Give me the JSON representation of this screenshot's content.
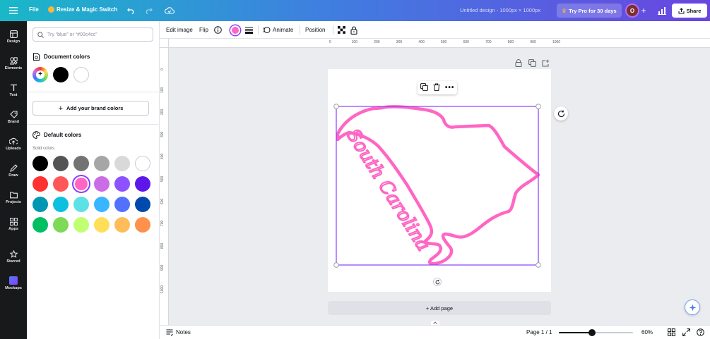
{
  "topbar": {
    "file_label": "File",
    "resize_label": "Resize & Magic Switch",
    "doc_title": "Untitled design - 1000px × 1000px",
    "try_pro_label": "Try Pro for 30 days",
    "avatar_letter": "O",
    "share_label": "Share"
  },
  "sidebar": {
    "items": [
      {
        "label": "Design",
        "icon": "design-icon"
      },
      {
        "label": "Elements",
        "icon": "elements-icon"
      },
      {
        "label": "Text",
        "icon": "text-icon"
      },
      {
        "label": "Brand",
        "icon": "brand-icon"
      },
      {
        "label": "Uploads",
        "icon": "uploads-icon"
      },
      {
        "label": "Draw",
        "icon": "draw-icon"
      },
      {
        "label": "Projects",
        "icon": "projects-icon"
      },
      {
        "label": "Apps",
        "icon": "apps-icon"
      },
      {
        "label": "Starred",
        "icon": "star-icon"
      },
      {
        "label": "Mockups",
        "icon": "mockups-icon"
      }
    ]
  },
  "panel": {
    "search_placeholder": "Try “blue” or “#00c4cc”",
    "document_colors_title": "Document colors",
    "document_colors": [
      "#000000",
      "#ffffff"
    ],
    "add_brand_label": "Add your brand colors",
    "default_colors_title": "Default colors",
    "solid_colors_label": "Solid colors",
    "solid_colors": [
      [
        "#000000",
        "#545454",
        "#737373",
        "#a6a6a6",
        "#d9d9d9",
        "#ffffff"
      ],
      [
        "#ff3131",
        "#ff5757",
        "#ff66c4",
        "#cb6ce6",
        "#8c52ff",
        "#5e17eb"
      ],
      [
        "#0097b2",
        "#0cc0df",
        "#5ce1e6",
        "#38b6ff",
        "#5271ff",
        "#004aad"
      ],
      [
        "#00bf63",
        "#7ed957",
        "#c1ff72",
        "#ffde59",
        "#ffbd59",
        "#ff914d"
      ]
    ],
    "selected_color": "#ff66c4"
  },
  "toolbar": {
    "edit_image_label": "Edit image",
    "flip_label": "Flip",
    "animate_label": "Animate",
    "position_label": "Position",
    "current_color": "#ff66c4"
  },
  "rulers": {
    "top": [
      "0",
      "100",
      "200",
      "300",
      "400",
      "500",
      "600",
      "700",
      "800",
      "900",
      "1000"
    ],
    "left": [
      "0",
      "100",
      "200",
      "300",
      "400",
      "500",
      "600",
      "700",
      "800",
      "900",
      "1000"
    ]
  },
  "canvas": {
    "design_text": "South Carolina",
    "stroke_color": "#ff66c4",
    "selection_color": "#8b3dff",
    "add_page_label": "+ Add page"
  },
  "bottombar": {
    "notes_label": "Notes",
    "page_indicator": "Page 1 / 1",
    "zoom_label": "60%",
    "zoom_value": 60
  }
}
